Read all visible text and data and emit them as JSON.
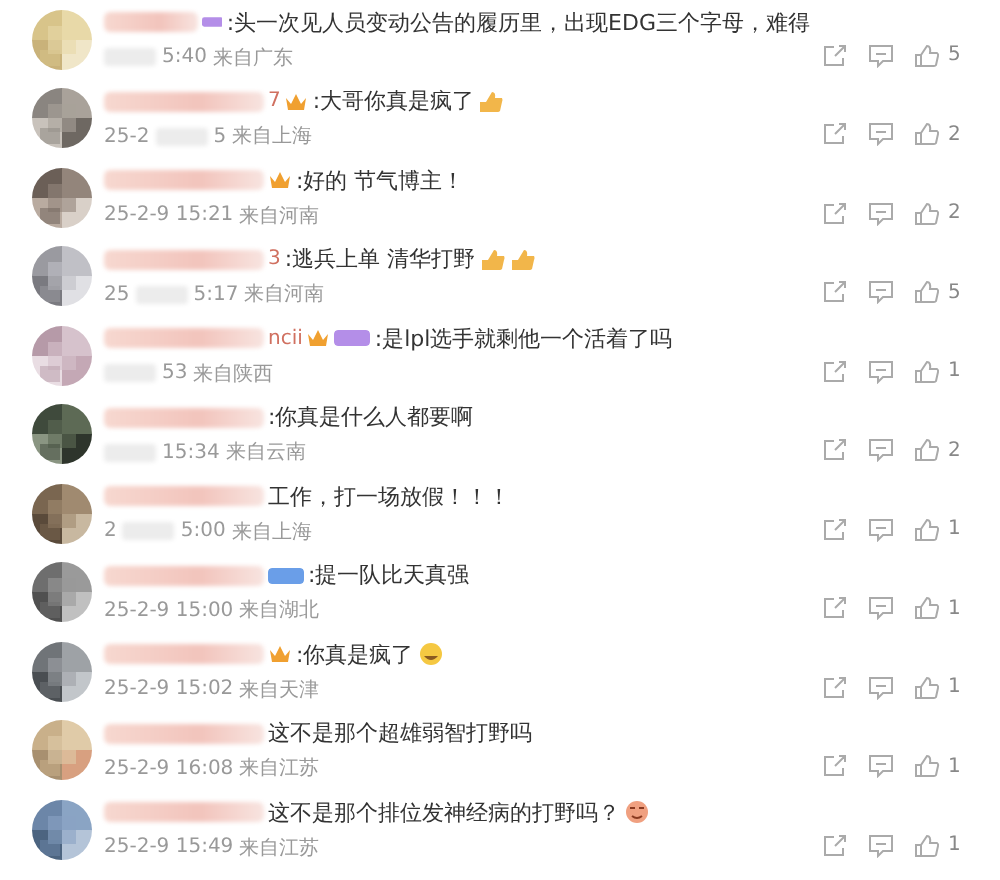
{
  "comments": [
    {
      "badges": [
        {
          "kind": "vip",
          "color": "#b48ee8"
        }
      ],
      "text": ":头一次见人员变动公告的履历里，出现EDG三个字母，难得",
      "time_lead_blur": true,
      "time_parts": [
        "5:40"
      ],
      "location": "来自广东",
      "likes": "5"
    },
    {
      "name_fragment": "7",
      "badges": [
        {
          "kind": "crown",
          "color": "#f0a030"
        }
      ],
      "text": ":大哥你真是疯了",
      "emojis": [
        {
          "kind": "thumbs"
        }
      ],
      "time_parts": [
        "25-2",
        "5"
      ],
      "location": "来自上海",
      "likes": "2"
    },
    {
      "badges": [
        {
          "kind": "crown",
          "color": "#f0a030"
        }
      ],
      "text": ":好的 节气博主！",
      "time_parts": [
        "25-2-9 15:21"
      ],
      "location": "来自河南",
      "likes": "2"
    },
    {
      "name_fragment": "3",
      "text": ":逃兵上单 清华打野",
      "emojis": [
        {
          "kind": "thumbs"
        },
        {
          "kind": "thumbs"
        }
      ],
      "time_parts": [
        "25",
        "5:17"
      ],
      "location": "来自河南",
      "likes": "5"
    },
    {
      "name_fragment": "ncii",
      "badges": [
        {
          "kind": "crown",
          "color": "#f0a030"
        },
        {
          "kind": "vip",
          "color": "#b48ee8"
        }
      ],
      "text": ":是lpl选手就剩他一个活着了吗",
      "time_lead_blur": true,
      "time_parts": [
        "53"
      ],
      "location": "来自陕西",
      "likes": "1"
    },
    {
      "text": ":你真是什么人都要啊",
      "time_lead_blur": true,
      "time_parts": [
        "15:34"
      ],
      "location": "来自云南",
      "likes": "2"
    },
    {
      "text": "工作，打一场放假！！！",
      "time_parts": [
        "2",
        "5:00"
      ],
      "location": "来自上海",
      "likes": "1"
    },
    {
      "badges": [
        {
          "kind": "vip",
          "color": "#6a9ee8"
        }
      ],
      "text": ":提一队比天真强",
      "time_parts": [
        "25-2-9 15:00"
      ],
      "location": "来自湖北",
      "likes": "1"
    },
    {
      "badges": [
        {
          "kind": "crown",
          "color": "#f0a030"
        }
      ],
      "text": ":你真是疯了",
      "emojis": [
        {
          "kind": "laugh"
        }
      ],
      "time_parts": [
        "25-2-9 15:02"
      ],
      "location": "来自天津",
      "likes": "1"
    },
    {
      "text": "这不是那个超雄弱智打野吗",
      "time_parts": [
        "25-2-9 16:08"
      ],
      "location": "来自江苏",
      "likes": "1"
    },
    {
      "text": "这不是那个排位发神经病的打野吗？",
      "emojis": [
        {
          "kind": "shy"
        }
      ],
      "time_parts": [
        "25-2-9 15:49"
      ],
      "location": "来自江苏",
      "likes": "1"
    }
  ]
}
